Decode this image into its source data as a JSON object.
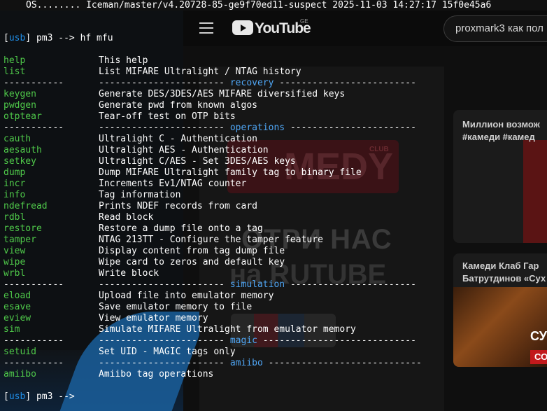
{
  "background": {
    "logo_text": "YouTube",
    "logo_region": "GE",
    "search_text": "proxmark3 как пол",
    "video_comedy_text": "MEDY",
    "video_club_text": "CLUB",
    "video_watch_text": "ОТРИ НАС",
    "video_rutube_text": "на RUTUBE",
    "card1_title_line1": "Миллион возмож",
    "card1_title_line2": "#камеди #камед",
    "card2_title_line1": "Камеди Клаб Гар",
    "card2_title_line2": "Батрутдинов «Сух",
    "card2_badge": "СУР",
    "card2_badge2": "СО"
  },
  "terminal": {
    "banner": "OS........ Iceman/master/v4.20728-85-ge9f70ed11-suspect 2025-11-03 14:27:17 15f0e45a6",
    "prompt_open": "[",
    "prompt_device": "usb",
    "prompt_close": "]",
    "prompt_command": " pm3 --> hf mfu",
    "prompt_final_rest": " pm3 -->",
    "separator_left": "-----------",
    "rows": [
      {
        "kind": "cmd",
        "name": "help",
        "desc": "This help"
      },
      {
        "kind": "cmd",
        "name": "list",
        "desc": "List MIFARE Ultralight / NTAG history"
      },
      {
        "kind": "sec",
        "pre": "----------------------- ",
        "label": "recovery",
        "post": " -------------------------"
      },
      {
        "kind": "cmd",
        "name": "keygen",
        "desc": "Generate DES/3DES/AES MIFARE diversified keys"
      },
      {
        "kind": "cmd",
        "name": "pwdgen",
        "desc": "Generate pwd from known algos"
      },
      {
        "kind": "cmd",
        "name": "otptear",
        "desc": "Tear-off test on OTP bits"
      },
      {
        "kind": "sec",
        "pre": "----------------------- ",
        "label": "operations",
        "post": " -----------------------"
      },
      {
        "kind": "cmd",
        "name": "cauth",
        "desc": "Ultralight C - Authentication"
      },
      {
        "kind": "cmd",
        "name": "aesauth",
        "desc": "Ultralight AES - Authentication"
      },
      {
        "kind": "cmd",
        "name": "setkey",
        "desc": "Ultralight C/AES - Set 3DES/AES keys"
      },
      {
        "kind": "cmd",
        "name": "dump",
        "desc": "Dump MIFARE Ultralight family tag to binary file"
      },
      {
        "kind": "cmd",
        "name": "incr",
        "desc": "Increments Ev1/NTAG counter"
      },
      {
        "kind": "cmd",
        "name": "info",
        "desc": "Tag information"
      },
      {
        "kind": "cmd",
        "name": "ndefread",
        "desc": "Prints NDEF records from card"
      },
      {
        "kind": "cmd",
        "name": "rdbl",
        "desc": "Read block"
      },
      {
        "kind": "cmd",
        "name": "restore",
        "desc": "Restore a dump file onto a tag"
      },
      {
        "kind": "cmd",
        "name": "tamper",
        "desc": "NTAG 213TT - Configure the tamper feature"
      },
      {
        "kind": "cmd",
        "name": "view",
        "desc": "Display content from tag dump file"
      },
      {
        "kind": "cmd",
        "name": "wipe",
        "desc": "Wipe card to zeros and default key"
      },
      {
        "kind": "cmd",
        "name": "wrbl",
        "desc": "Write block"
      },
      {
        "kind": "sec",
        "pre": "----------------------- ",
        "label": "simulation",
        "post": " -----------------------"
      },
      {
        "kind": "cmd",
        "name": "eload",
        "desc": "Upload file into emulator memory"
      },
      {
        "kind": "cmd",
        "name": "esave",
        "desc": "Save emulator memory to file"
      },
      {
        "kind": "cmd",
        "name": "eview",
        "desc": "View emulator memory"
      },
      {
        "kind": "cmd",
        "name": "sim",
        "desc": "Simulate MIFARE Ultralight from emulator memory"
      },
      {
        "kind": "sec",
        "pre": "----------------------- ",
        "label": "magic",
        "post": " ----------------------------"
      },
      {
        "kind": "cmd",
        "name": "setuid",
        "desc": "Set UID - MAGIC tags only"
      },
      {
        "kind": "sec",
        "pre": "----------------------- ",
        "label": "amiibo",
        "post": " ----------------------------"
      },
      {
        "kind": "cmd",
        "name": "amiibo",
        "desc": "Amiibo tag operations"
      }
    ]
  },
  "colors": {
    "command_green": "#4fc94a",
    "section_blue": "#4fa6f5",
    "device_blue": "#1f8ee8",
    "text_white": "#ffffff"
  }
}
